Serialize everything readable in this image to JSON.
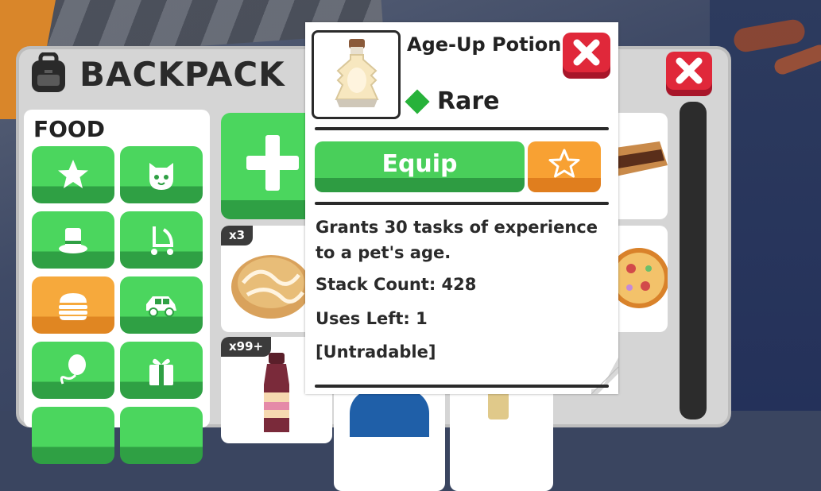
{
  "backpack": {
    "title": "BACKPACK",
    "category_title": "FOOD"
  },
  "items": [
    {
      "badge": "x3",
      "name": "Cinnamon Roll"
    },
    {
      "badge": "x99+",
      "name": "Drink"
    }
  ],
  "tooltip": {
    "item_name": "Age-Up Potion",
    "rarity": "Rare",
    "equip_label": "Equip",
    "description": "Grants 30 tasks of experience to a pet's age.",
    "stack_count": "Stack Count: 428",
    "uses_left": "Uses Left: 1",
    "tradable": "[Untradable]"
  },
  "colors": {
    "green": "#4bd65e",
    "orange": "#f6a93c",
    "close_red": "#e0283a",
    "rarity_green": "#27b23a"
  },
  "icons": [
    "backpack-icon",
    "close-icon",
    "star-icon",
    "cat-icon",
    "top-hat-icon",
    "stroller-icon",
    "burger-icon",
    "car-icon",
    "balloon-icon",
    "gift-icon",
    "plus-icon",
    "potion-icon"
  ]
}
